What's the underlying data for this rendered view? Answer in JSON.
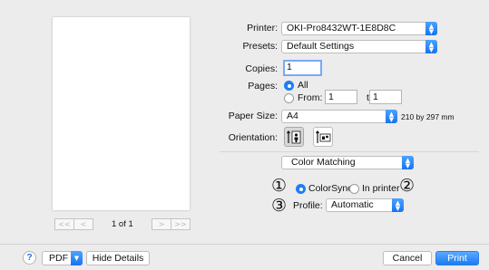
{
  "pager": {
    "first_label": "<<",
    "prev_label": "<",
    "next_label": ">",
    "last_label": ">>",
    "page_status": "1 of 1"
  },
  "printer": {
    "label": "Printer:",
    "value": "OKI-Pro8432WT-1E8D8C"
  },
  "presets": {
    "label": "Presets:",
    "value": "Default Settings"
  },
  "copies": {
    "label": "Copies:",
    "value": "1"
  },
  "pages": {
    "label": "Pages:",
    "all_label": "All",
    "from_label": "From:",
    "from_value": "1",
    "to_label": "to:",
    "to_value": "1",
    "selected": "All"
  },
  "paper_size": {
    "label": "Paper Size:",
    "value": "A4",
    "dimensions": "210 by 297 mm"
  },
  "orientation": {
    "label": "Orientation:",
    "selected": "portrait"
  },
  "section": {
    "value": "Color Matching"
  },
  "color_matching": {
    "marker_1": "①",
    "marker_2": "②",
    "marker_3": "③",
    "colorsync_label": "ColorSync",
    "in_printer_label": "In printer",
    "selected": "ColorSync",
    "profile_label": "Profile:",
    "profile_value": "Automatic"
  },
  "footer": {
    "help_label": "?",
    "pdf_label": "PDF",
    "hide_details_label": "Hide Details",
    "cancel_label": "Cancel",
    "print_label": "Print"
  },
  "colors": {
    "accent": "#1e7ef5",
    "background": "#ececec",
    "focus_ring": "#78a9f5"
  }
}
